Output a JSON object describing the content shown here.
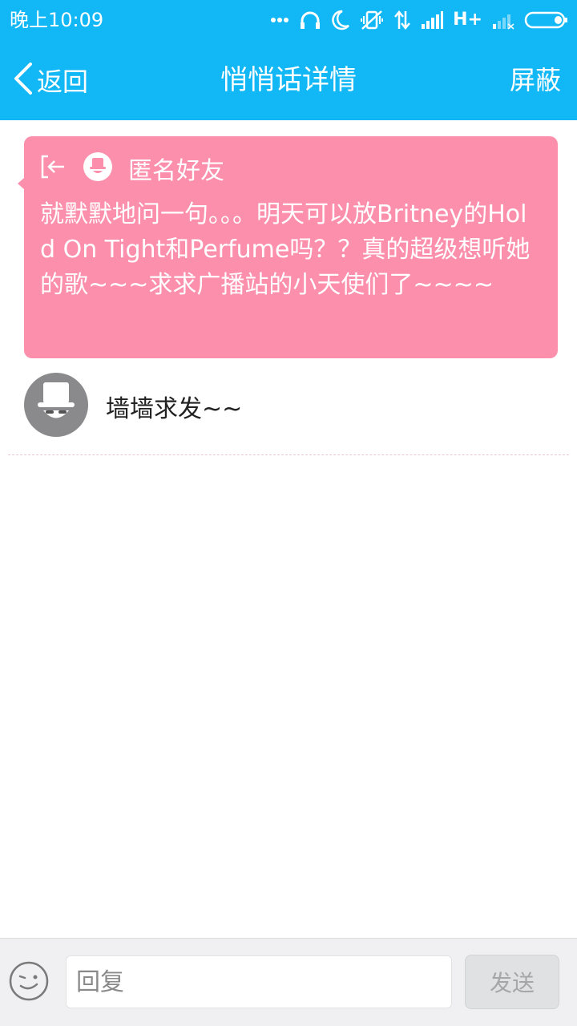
{
  "status_bar": {
    "time": "晚上10:09",
    "network_type": "H+",
    "icons": [
      "more-dots-icon",
      "headphones-icon",
      "moon-icon",
      "vibrate-off-icon",
      "data-transfer-icon",
      "signal-icon",
      "signal-weak-icon",
      "battery-icon"
    ]
  },
  "header": {
    "back_label": "返回",
    "title": "悄悄话详情",
    "block_label": "屏蔽",
    "background": "#12b7f5"
  },
  "message": {
    "sender": "匿名好友",
    "text": "就默默地问一句。。。明天可以放Britney的Hold On Tight和Perfume吗？？真的超级想听她的歌~~~求求广播站的小天使们了~~~~",
    "background": "#fc8fab"
  },
  "replies": [
    {
      "avatar": "anonymous-avatar-icon",
      "text": "墙墙求发~~"
    }
  ],
  "input_bar": {
    "placeholder": "回复",
    "send_label": "发送",
    "emoji_icon": "emoji-icon"
  }
}
